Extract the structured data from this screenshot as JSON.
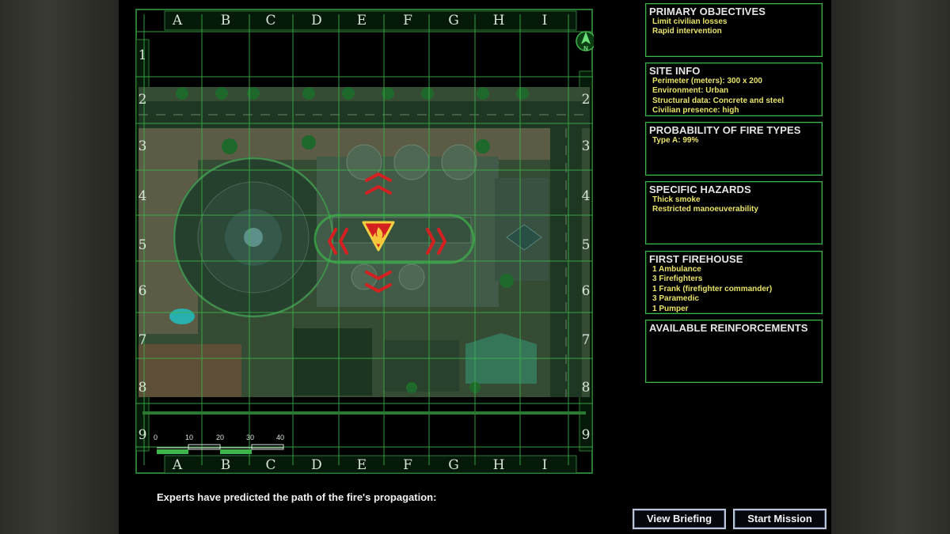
{
  "map": {
    "columns": [
      "A",
      "B",
      "C",
      "D",
      "E",
      "F",
      "G",
      "H",
      "I"
    ],
    "rows": [
      "1",
      "2",
      "3",
      "4",
      "5",
      "6",
      "7",
      "8",
      "9"
    ],
    "scale_ticks": [
      "0",
      "10",
      "20",
      "30",
      "40"
    ],
    "compass": "N"
  },
  "panels": [
    {
      "title": "PRIMARY OBJECTIVES",
      "lines": [
        "Limit civilian losses",
        "Rapid intervention"
      ]
    },
    {
      "title": "SITE INFO",
      "lines": [
        "Perimeter (meters): 300 x 200",
        "Environment: Urban",
        "Structural data: Concrete and steel",
        "Civilian presence: high"
      ]
    },
    {
      "title": "PROBABILITY OF FIRE TYPES",
      "lines": [
        "Type A: 99%"
      ]
    },
    {
      "title": "SPECIFIC HAZARDS",
      "lines": [
        "Thick smoke",
        "Restricted manoeuverability"
      ]
    },
    {
      "title": "FIRST FIREHOUSE",
      "lines": [
        "1 Ambulance",
        "3 Firefighters",
        "1 Frank (firefighter commander)",
        "3 Paramedic",
        "1 Pumper"
      ]
    },
    {
      "title": "AVAILABLE REINFORCEMENTS",
      "lines": []
    }
  ],
  "caption": "Experts have predicted the path of the fire's propagation:",
  "buttons": {
    "view_briefing": "View Briefing",
    "start_mission": "Start Mission"
  },
  "colors": {
    "grid": "#3db54a",
    "objective_text": "#e8e36a",
    "fire_marker": "#d42020"
  }
}
